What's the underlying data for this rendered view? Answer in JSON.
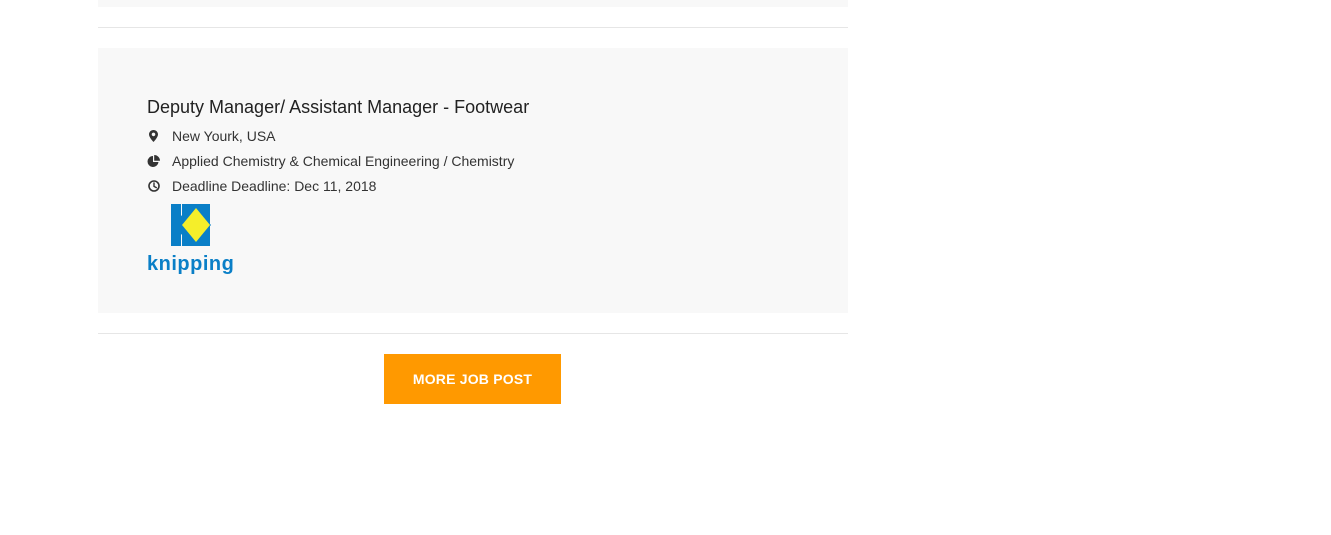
{
  "job": {
    "title": "Deputy Manager/ Assistant Manager - Footwear",
    "location": "New Yourk, USA",
    "category": "Applied Chemistry & Chemical Engineering / Chemistry",
    "deadline": "Deadline Deadline: Dec 11, 2018",
    "company_logo_text": "knipping",
    "icons": {
      "location": "map-marker-icon",
      "category": "pie-chart-icon",
      "deadline": "clock-icon"
    },
    "logo_colors": {
      "blue": "#0a7fc7",
      "yellow": "#f5ee2a"
    }
  },
  "actions": {
    "more_label": "MORE JOB POST"
  },
  "colors": {
    "card_bg": "#f8f8f8",
    "button_bg": "#ff9900",
    "divider": "#e6e6e6"
  }
}
